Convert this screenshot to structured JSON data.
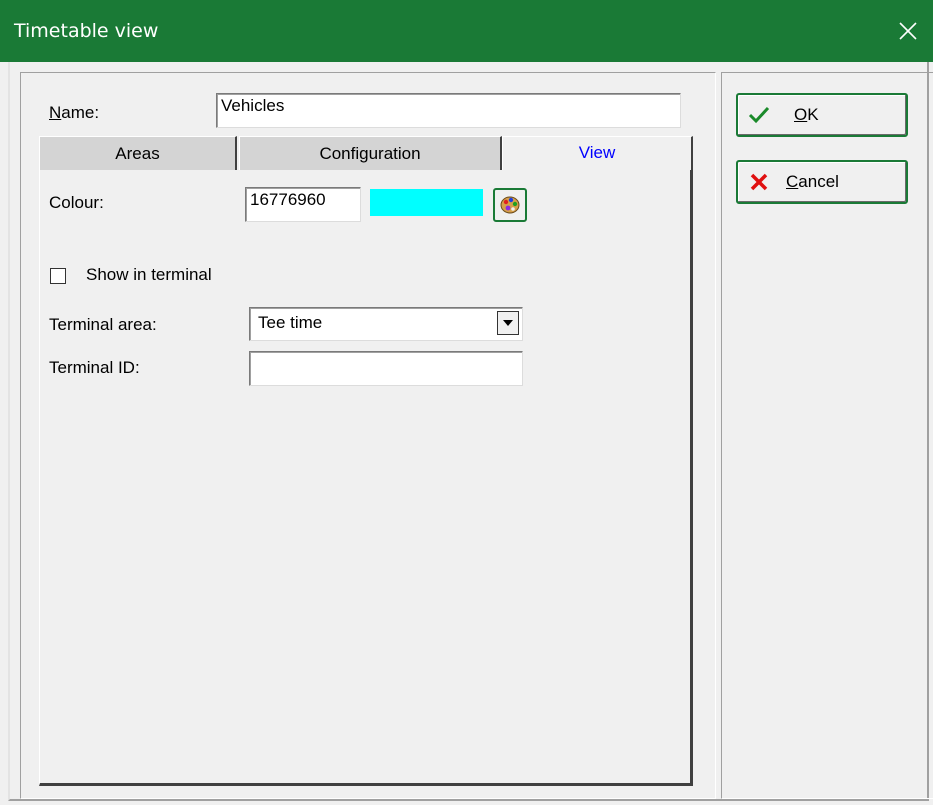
{
  "window": {
    "title": "Timetable view",
    "close_icon": "close-icon"
  },
  "form": {
    "name_label_underlined": "N",
    "name_label_rest": "ame:",
    "name_value": "Vehicles"
  },
  "tabs": [
    {
      "label": "Areas",
      "active": false
    },
    {
      "label": "Configuration",
      "active": false
    },
    {
      "label": "View",
      "active": true
    }
  ],
  "view_tab": {
    "colour_label": "Colour:",
    "colour_value": "16776960",
    "colour_swatch": "#00ffff",
    "palette_icon": "palette-icon",
    "show_in_terminal_label": "Show in terminal",
    "show_in_terminal_checked": false,
    "terminal_area_label": "Terminal area:",
    "terminal_area_value": "Tee time",
    "terminal_id_label": "Terminal ID:",
    "terminal_id_value": ""
  },
  "buttons": {
    "ok_underlined": "O",
    "ok_rest": "K",
    "ok_icon": "checkmark-icon",
    "cancel_underlined": "C",
    "cancel_rest": "ancel",
    "cancel_icon": "x-icon"
  },
  "colors": {
    "titlebar": "#1a7a36",
    "active_tab_text": "#0000ff",
    "button_border": "#1a7a36"
  }
}
